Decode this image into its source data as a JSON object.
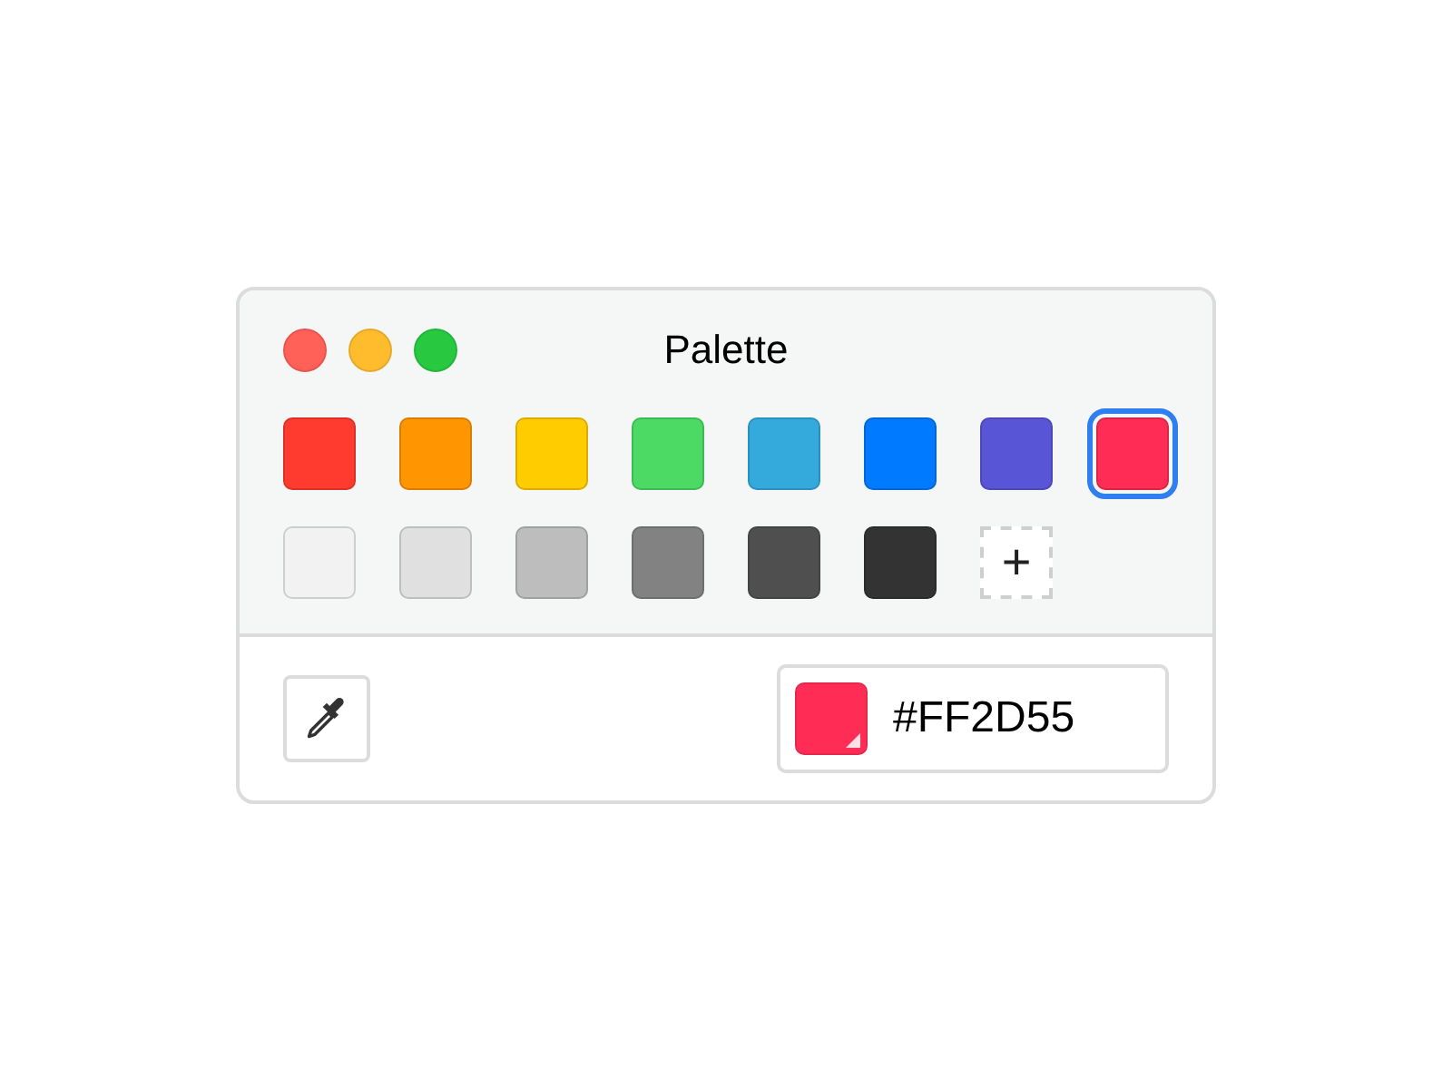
{
  "window": {
    "title": "Palette"
  },
  "swatches": [
    {
      "kind": "color",
      "color": "#ff3b30",
      "selected": false
    },
    {
      "kind": "color",
      "color": "#ff9500",
      "selected": false
    },
    {
      "kind": "color",
      "color": "#ffcc00",
      "selected": false
    },
    {
      "kind": "color",
      "color": "#4cd964",
      "selected": false
    },
    {
      "kind": "color",
      "color": "#34aadc",
      "selected": false
    },
    {
      "kind": "color",
      "color": "#007aff",
      "selected": false
    },
    {
      "kind": "color",
      "color": "#5856d6",
      "selected": false
    },
    {
      "kind": "color",
      "color": "#ff2d55",
      "selected": true
    },
    {
      "kind": "color",
      "color": "#f2f2f2",
      "selected": false
    },
    {
      "kind": "color",
      "color": "#e0e0e0",
      "selected": false
    },
    {
      "kind": "color",
      "color": "#bdbdbd",
      "selected": false
    },
    {
      "kind": "color",
      "color": "#828282",
      "selected": false
    },
    {
      "kind": "color",
      "color": "#4f4f4f",
      "selected": false
    },
    {
      "kind": "color",
      "color": "#333333",
      "selected": false
    },
    {
      "kind": "add",
      "label": "+"
    }
  ],
  "current": {
    "color": "#ff2d55",
    "value": "#FF2D55"
  }
}
